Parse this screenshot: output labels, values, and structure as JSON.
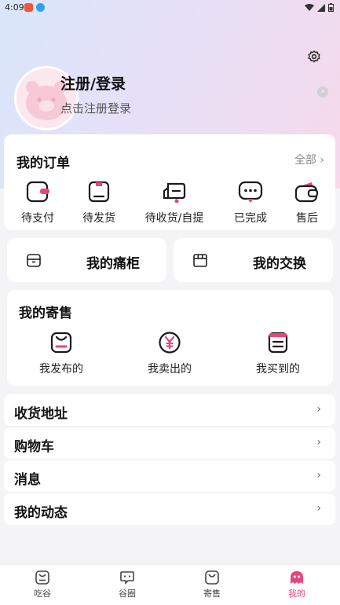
{
  "status_bar": {
    "time": "4:09"
  },
  "profile": {
    "title": "注册/登录",
    "subtitle": "点击注册登录"
  },
  "orders": {
    "title": "我的订单",
    "all_label": "全部",
    "items": [
      {
        "label": "待支付",
        "icon": "wallet-pending-icon"
      },
      {
        "label": "待发货",
        "icon": "box-icon"
      },
      {
        "label": "待收货/自提",
        "icon": "truck-icon"
      },
      {
        "label": "已完成",
        "icon": "chat-done-icon"
      },
      {
        "label": "售后",
        "icon": "wallet-icon"
      }
    ]
  },
  "shortcuts": [
    {
      "label": "我的痛柜",
      "icon": "cabinet-icon"
    },
    {
      "label": "我的交换",
      "icon": "store-icon"
    }
  ],
  "consign": {
    "title": "我的寄售",
    "items": [
      {
        "label": "我发布的",
        "icon": "bag-icon"
      },
      {
        "label": "我卖出的",
        "icon": "yen-icon"
      },
      {
        "label": "我买到的",
        "icon": "receipt-icon"
      }
    ]
  },
  "menu": [
    {
      "label": "收货地址"
    },
    {
      "label": "购物车"
    },
    {
      "label": "消息"
    },
    {
      "label": "我的动态"
    }
  ],
  "tabs": [
    {
      "label": "吃谷",
      "active": false
    },
    {
      "label": "谷圈",
      "active": false
    },
    {
      "label": "寄售",
      "active": false
    },
    {
      "label": "我的",
      "active": true
    }
  ],
  "colors": {
    "accent": "#e8467b",
    "hero_start": "#d9e6fb",
    "hero_end": "#f6d9ea"
  }
}
